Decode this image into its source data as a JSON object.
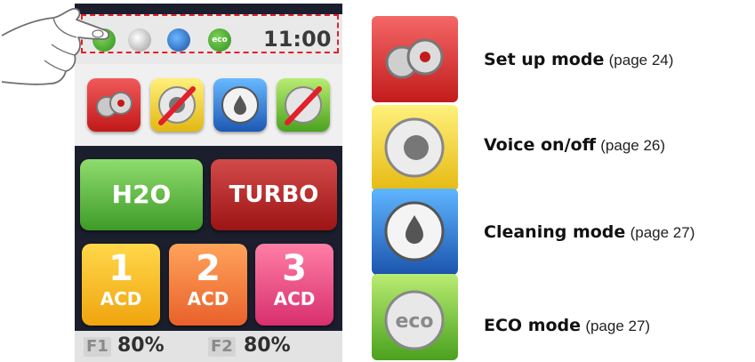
{
  "status_bar": {
    "time": "11:00",
    "icons": [
      "setup-gear-icon",
      "speaker-icon",
      "cleaning-drop-icon",
      "eco-icon"
    ],
    "eco_label": "eco"
  },
  "mode_tiles": [
    "setup-gear-icon",
    "voice-off-icon",
    "cleaning-icon",
    "eco-off-icon"
  ],
  "buttons": {
    "h2o": "H2O",
    "turbo": "TURBO"
  },
  "acd": [
    {
      "number": "1",
      "label": "ACD"
    },
    {
      "number": "2",
      "label": "ACD"
    },
    {
      "number": "3",
      "label": "ACD"
    }
  ],
  "footer": {
    "f1_label": "F1",
    "f1_value": "80%",
    "f2_label": "F2",
    "f2_value": "80%"
  },
  "legend": [
    {
      "title": "Set up mode",
      "page": "(page 24)"
    },
    {
      "title": "Voice on/off",
      "page": "(page 26)"
    },
    {
      "title": "Cleaning mode",
      "page": "(page 27)"
    },
    {
      "title": "ECO mode",
      "page": "(page 27)"
    }
  ],
  "colors": {
    "setup": "#d42a2a",
    "voice": "#f0c623",
    "cleaning": "#2b6fcb",
    "eco": "#6bbf35",
    "highlight_dashed": "#e2202a"
  }
}
